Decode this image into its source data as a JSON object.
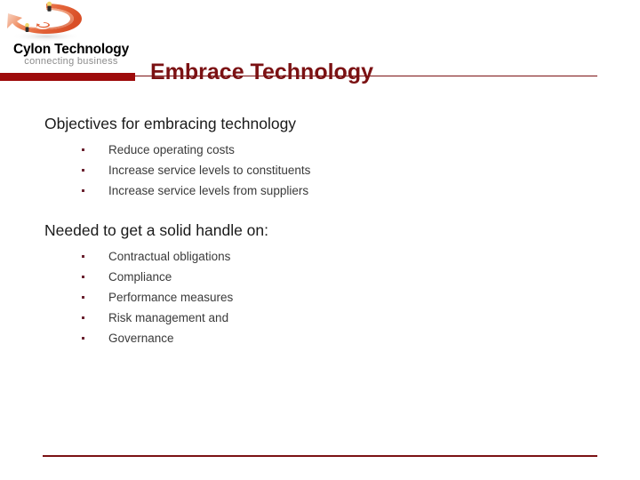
{
  "slide": {
    "title": "Embrace Technology",
    "logo": {
      "name": "Cylon Technology",
      "tagline": "connecting business",
      "mark_icon": "swoosh-ring-icon"
    },
    "colors": {
      "title": "#7b1113",
      "accent_bar": "#9e0b0b",
      "rule": "#7b1113",
      "heading_text": "#1a1a1a",
      "body_text": "#3a3a3a",
      "bullet_marker": "#6b2230",
      "logo_name": "#000000",
      "logo_tagline": "#8c8c8c",
      "background": "#ffffff"
    },
    "sections": [
      {
        "heading": "Objectives for embracing technology",
        "bullets": [
          "Reduce operating costs",
          "Increase service levels to constituents",
          "Increase service levels from suppliers"
        ]
      },
      {
        "heading": "Needed to get a solid handle on:",
        "bullets": [
          "Contractual obligations",
          "Compliance",
          "Performance measures",
          "Risk management and",
          "Governance"
        ]
      }
    ]
  }
}
